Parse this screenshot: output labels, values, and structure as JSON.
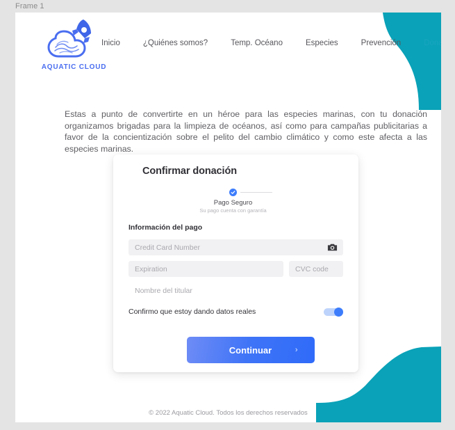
{
  "frame": {
    "label": "Frame 1"
  },
  "theme": {
    "accent_blue": "#3d7dfc",
    "brand_blue": "#4a6ef0",
    "teal": "#0aa2b8",
    "page_bg": "#ffffff",
    "canvas_bg": "#e4e4e4",
    "field_bg": "#f1f1f3"
  },
  "header": {
    "brand_name": "AQUATIC CLOUD",
    "logo_icon": "cloud-rocket-wave-icon",
    "nav_items": [
      {
        "label": "Inicio",
        "accent": false
      },
      {
        "label": "¿Quiénes somos?",
        "accent": false
      },
      {
        "label": "Temp. Océano",
        "accent": false
      },
      {
        "label": "Especies",
        "accent": false
      },
      {
        "label": "Prevención",
        "accent": false
      },
      {
        "label": "Donar",
        "accent": true
      }
    ]
  },
  "hero": {
    "paragraph": "Estas a punto de convertirte en un héroe para las especies marinas, con tu donación organizamos brigadas para la limpieza de océanos, así como para campañas publicitarias a favor de la concientización sobre el pelito del cambio climático y como este afecta a las especies marinas."
  },
  "card": {
    "title": "Confirmar donación",
    "stepper": {
      "check_icon": "check-circle-icon",
      "label": "Pago Seguro",
      "sublabel": "Su pago cuenta con garantía"
    },
    "section_title": "Información del pago",
    "fields": {
      "card_number": {
        "placeholder": "Credit Card Number",
        "value": ""
      },
      "expiration": {
        "placeholder": "Expiration",
        "value": ""
      },
      "cvc": {
        "placeholder": "CVC code",
        "value": ""
      },
      "holder_name": {
        "placeholder": "Nombre del titular",
        "value": ""
      }
    },
    "camera_icon": "camera-icon",
    "confirm": {
      "label": "Confirmo que estoy dando datos reales",
      "toggle_state": "on"
    },
    "continue_button": {
      "label": "Continuar",
      "chevron_icon": "chevron-right-icon"
    }
  },
  "footer": {
    "copyright": "© 2022 Aquatic Cloud. Todos los derechos reservados"
  }
}
